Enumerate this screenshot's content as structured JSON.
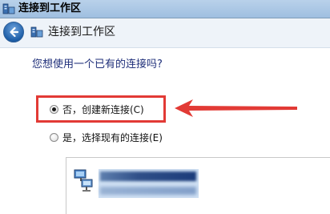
{
  "window": {
    "title": "连接到工作区"
  },
  "header": {
    "title": "连接到工作区"
  },
  "question": "您想使用一个已有的连接吗?",
  "options": [
    {
      "label": "否，创建新连接(C)",
      "selected": true
    },
    {
      "label": "是，选择现有的连接(E)",
      "selected": false
    }
  ],
  "annotation": {
    "color": "#e23a35"
  },
  "icons": {
    "title": "network-workplace-icon",
    "back": "back-arrow-icon",
    "connection": "network-connection-icon"
  }
}
